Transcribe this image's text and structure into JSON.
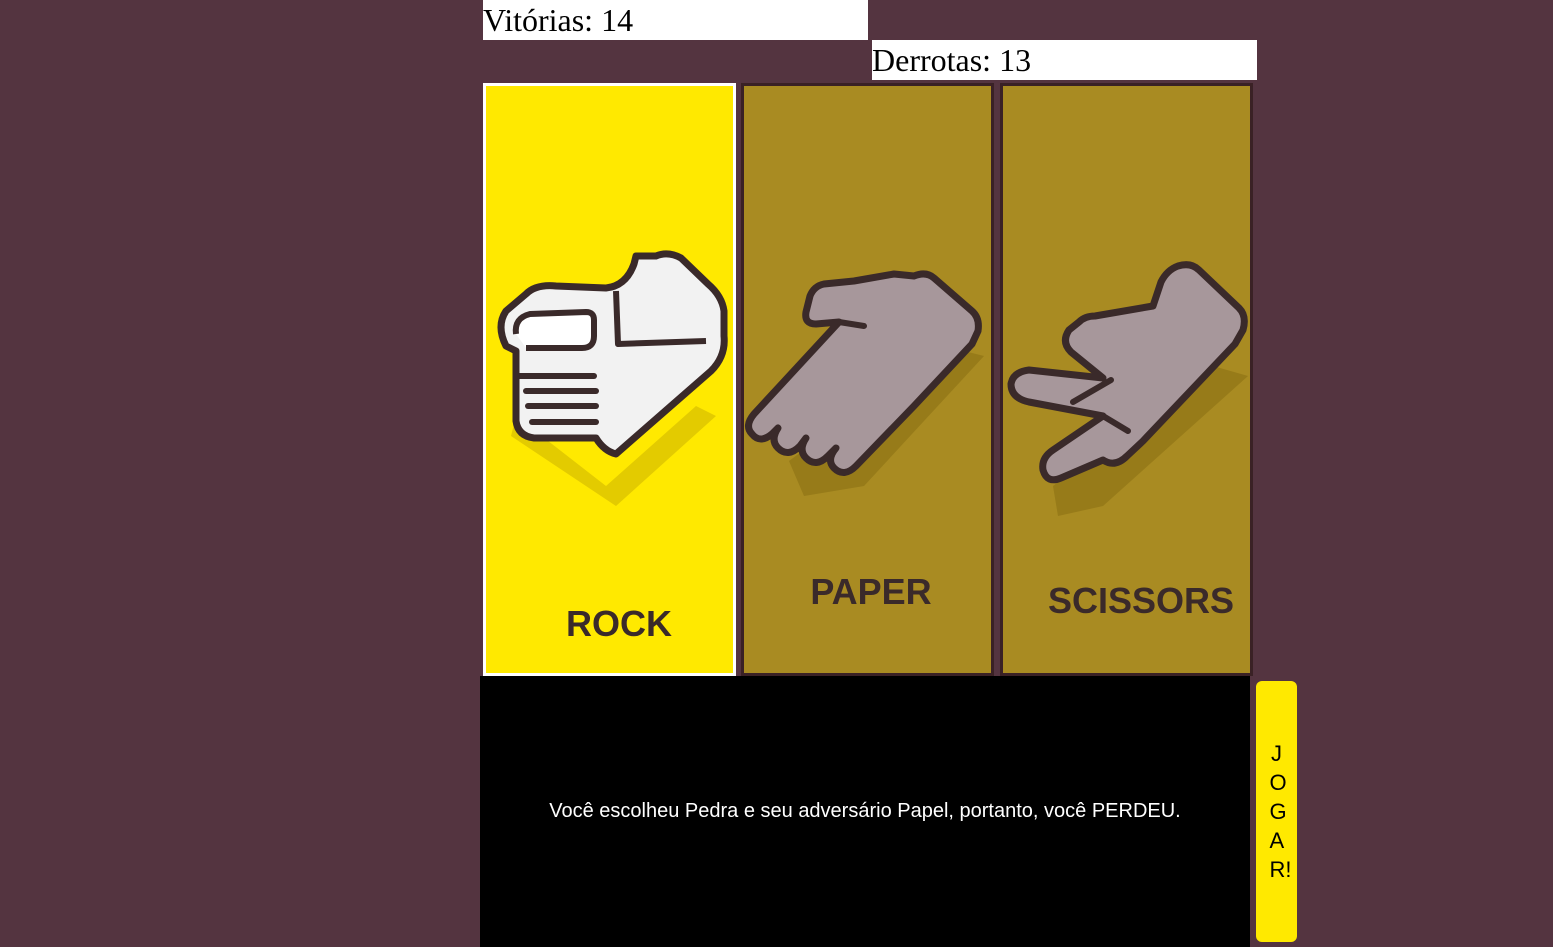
{
  "scoreboard": {
    "wins_text": "Vitórias: 14",
    "losses_text": "Derrotas: 13"
  },
  "choices": [
    {
      "label": "ROCK",
      "selected": true,
      "icon": "fist-icon"
    },
    {
      "label": "PAPER",
      "selected": false,
      "icon": "open-hand-icon"
    },
    {
      "label": "SCISSORS",
      "selected": false,
      "icon": "scissors-hand-icon"
    }
  ],
  "result": {
    "message": "Você escolheu Pedra e seu adversário Papel, portanto, você PERDEU."
  },
  "play_button": {
    "label": "JOGAR!"
  },
  "colors": {
    "background": "#543440",
    "card_selected": "#ffe900",
    "card_unselected": "#a98b22",
    "result_panel": "#000000",
    "button": "#ffe900"
  }
}
